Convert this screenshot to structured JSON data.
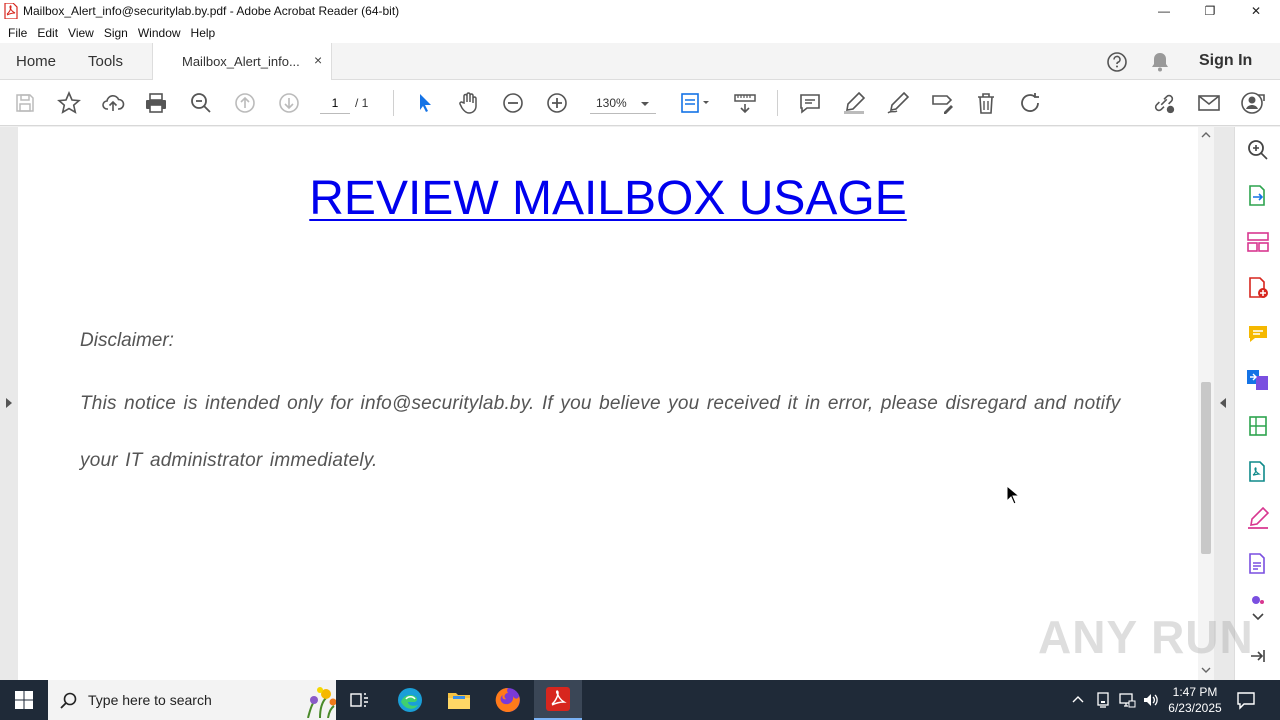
{
  "window": {
    "title": "Mailbox_Alert_info@securitylab.by.pdf - Adobe Acrobat Reader (64-bit)",
    "controls": {
      "minimize": "—",
      "maximize": "❐",
      "close": "✕"
    }
  },
  "menu": [
    "File",
    "Edit",
    "View",
    "Sign",
    "Window",
    "Help"
  ],
  "tabs": {
    "home": "Home",
    "tools": "Tools",
    "document": "Mailbox_Alert_info...",
    "close": "×",
    "sign_in": "Sign In"
  },
  "toolbar": {
    "page_current": "1",
    "page_total": "/ 1",
    "zoom": "130%"
  },
  "document": {
    "heading": "REVIEW MAILBOX USAGE",
    "disclaimer_label": "Disclaimer:",
    "disclaimer_text": "This notice is intended only for info@securitylab.by. If you believe you received it in error, please disregard and notify your IT administrator immediately."
  },
  "watermark": "ANY RUN",
  "taskbar": {
    "search_placeholder": "Type here to search",
    "time": "1:47 PM",
    "date": "6/23/2025"
  },
  "colors": {
    "link_blue": "#0000ee",
    "acrobat_red": "#d7261e",
    "tool_blue": "#1473e6",
    "taskbar": "#1f2a38"
  }
}
